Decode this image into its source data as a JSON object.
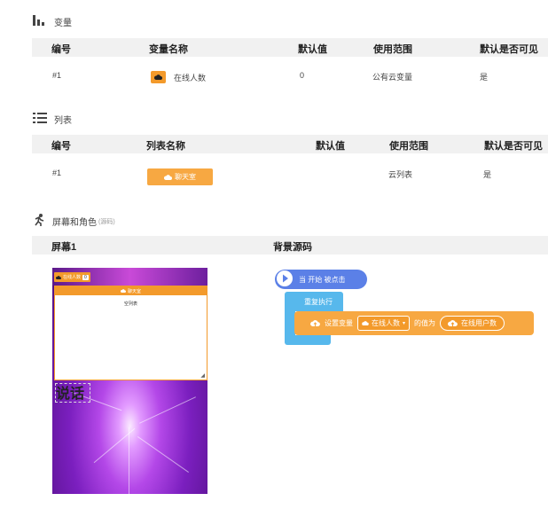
{
  "variables_section": {
    "title": "变量"
  },
  "var_table": {
    "headers": [
      "编号",
      "变量名称",
      "默认值",
      "使用范围",
      "默认是否可见"
    ],
    "row": {
      "id": "#1",
      "name": "在线人数",
      "default": "0",
      "scope": "公有云变量",
      "visible": "是"
    }
  },
  "lists_section": {
    "title": "列表"
  },
  "list_table": {
    "headers": [
      "编号",
      "列表名称",
      "默认值",
      "使用范围",
      "默认是否可见"
    ],
    "row": {
      "id": "#1",
      "name": "聊天室",
      "scope": "云列表",
      "visible": "是"
    }
  },
  "screens_section": {
    "title": "屏幕和角色",
    "note": "(源码)"
  },
  "screen_header": {
    "screen": "屏幕1",
    "background_code": "背景源码"
  },
  "stage": {
    "monitor_label": "在线人数",
    "monitor_value": "0",
    "list_title": "聊天室",
    "list_empty": "空列表",
    "speech": "说话"
  },
  "blocks": {
    "event": "当 开始 被点击",
    "loop": "重复执行",
    "set_prefix": "设置变量",
    "set_var": "在线人数",
    "set_mid": "的值为",
    "set_value": "在线用户数"
  },
  "colors": {
    "accent_orange": "#f7a842",
    "event_blue": "#5b80e7",
    "loop_blue": "#57b8ec"
  }
}
